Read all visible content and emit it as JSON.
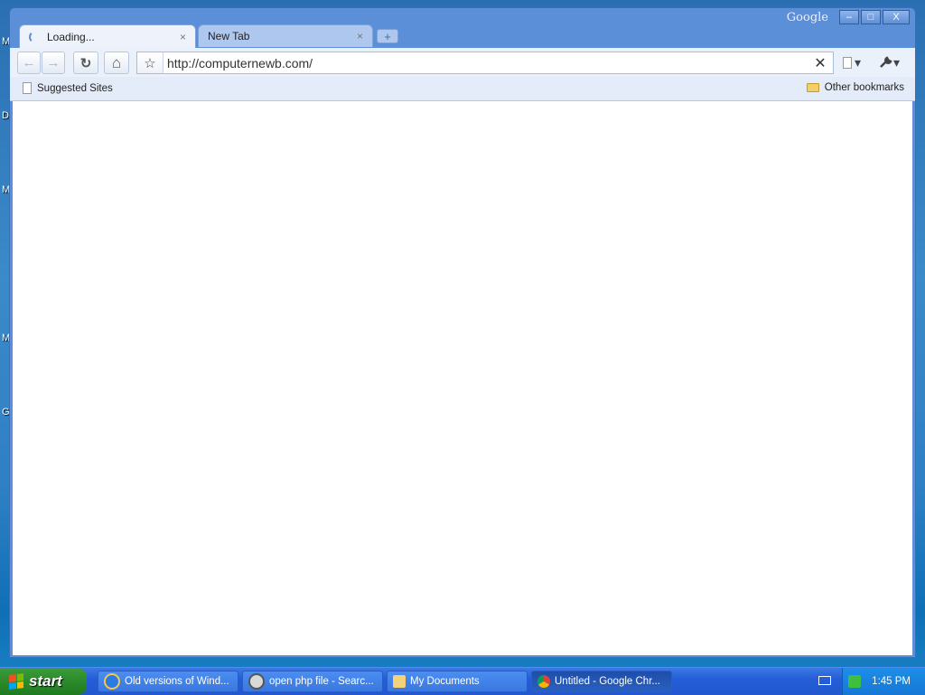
{
  "desktop": {
    "edge_letters": [
      "M",
      "D",
      "M",
      "M",
      "G"
    ]
  },
  "window": {
    "brand": "Google",
    "controls": {
      "minimize": "–",
      "maximize": "□",
      "close": "X"
    }
  },
  "tabs": [
    {
      "title": "Loading...",
      "close": "×"
    },
    {
      "title": "New Tab",
      "close": "×"
    }
  ],
  "new_tab_label": "+",
  "toolbar": {
    "back": "←",
    "forward": "→",
    "reload": "↻",
    "home": "⌂",
    "star": "☆",
    "url": "http://computernewb.com/",
    "stop": "✕",
    "page_menu": "▾",
    "wrench_menu": "▾"
  },
  "bookmarks": {
    "suggested": "Suggested Sites",
    "other": "Other bookmarks"
  },
  "taskbar": {
    "start_label": "start",
    "buttons": [
      {
        "label": "Old versions of Wind..."
      },
      {
        "label": "open php file - Searc..."
      },
      {
        "label": "My Documents"
      },
      {
        "label": "Untitled - Google Chr..."
      }
    ],
    "clock": "1:45 PM"
  }
}
